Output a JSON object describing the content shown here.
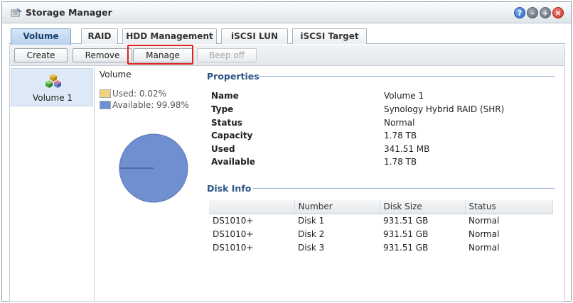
{
  "window": {
    "title": "Storage Manager",
    "title_icon": "storage-manager-icon"
  },
  "window_controls": {
    "help": "?",
    "minimize": "–",
    "maximize": "+",
    "close": "×"
  },
  "tabs": [
    "Volume",
    "RAID",
    "HDD Management",
    "iSCSI LUN",
    "iSCSI Target"
  ],
  "active_tab": "Volume",
  "toolbar": {
    "create": "Create",
    "remove": "Remove",
    "manage": "Manage",
    "beep_off": "Beep off"
  },
  "sidebar": {
    "items": [
      {
        "label": "Volume 1",
        "icon": "volume-cubes-icon",
        "selected": true
      }
    ]
  },
  "usage": {
    "title": "Volume",
    "used_label": "Used: 0.02%",
    "available_label": "Available: 99.98%",
    "used_percent": 0.02,
    "available_percent": 99.98,
    "used_color": "#f3d27f",
    "available_color": "#6f8fd0"
  },
  "properties": {
    "title": "Properties",
    "rows": [
      {
        "key": "Name",
        "value": "Volume 1"
      },
      {
        "key": "Type",
        "value": "Synology Hybrid RAID (SHR)"
      },
      {
        "key": "Status",
        "value": "Normal"
      },
      {
        "key": "Capacity",
        "value": "1.78 TB"
      },
      {
        "key": "Used",
        "value": "341.51 MB"
      },
      {
        "key": "Available",
        "value": "1.78 TB"
      }
    ]
  },
  "disk_info": {
    "title": "Disk Info",
    "columns": [
      "",
      "Number",
      "Disk Size",
      "Status"
    ],
    "rows": [
      {
        "model": "DS1010+",
        "number": "Disk 1",
        "size": "931.51 GB",
        "status": "Normal"
      },
      {
        "model": "DS1010+",
        "number": "Disk 2",
        "size": "931.51 GB",
        "status": "Normal"
      },
      {
        "model": "DS1010+",
        "number": "Disk 3",
        "size": "931.51 GB",
        "status": "Normal"
      }
    ],
    "status_color": "#2f8a2a"
  }
}
